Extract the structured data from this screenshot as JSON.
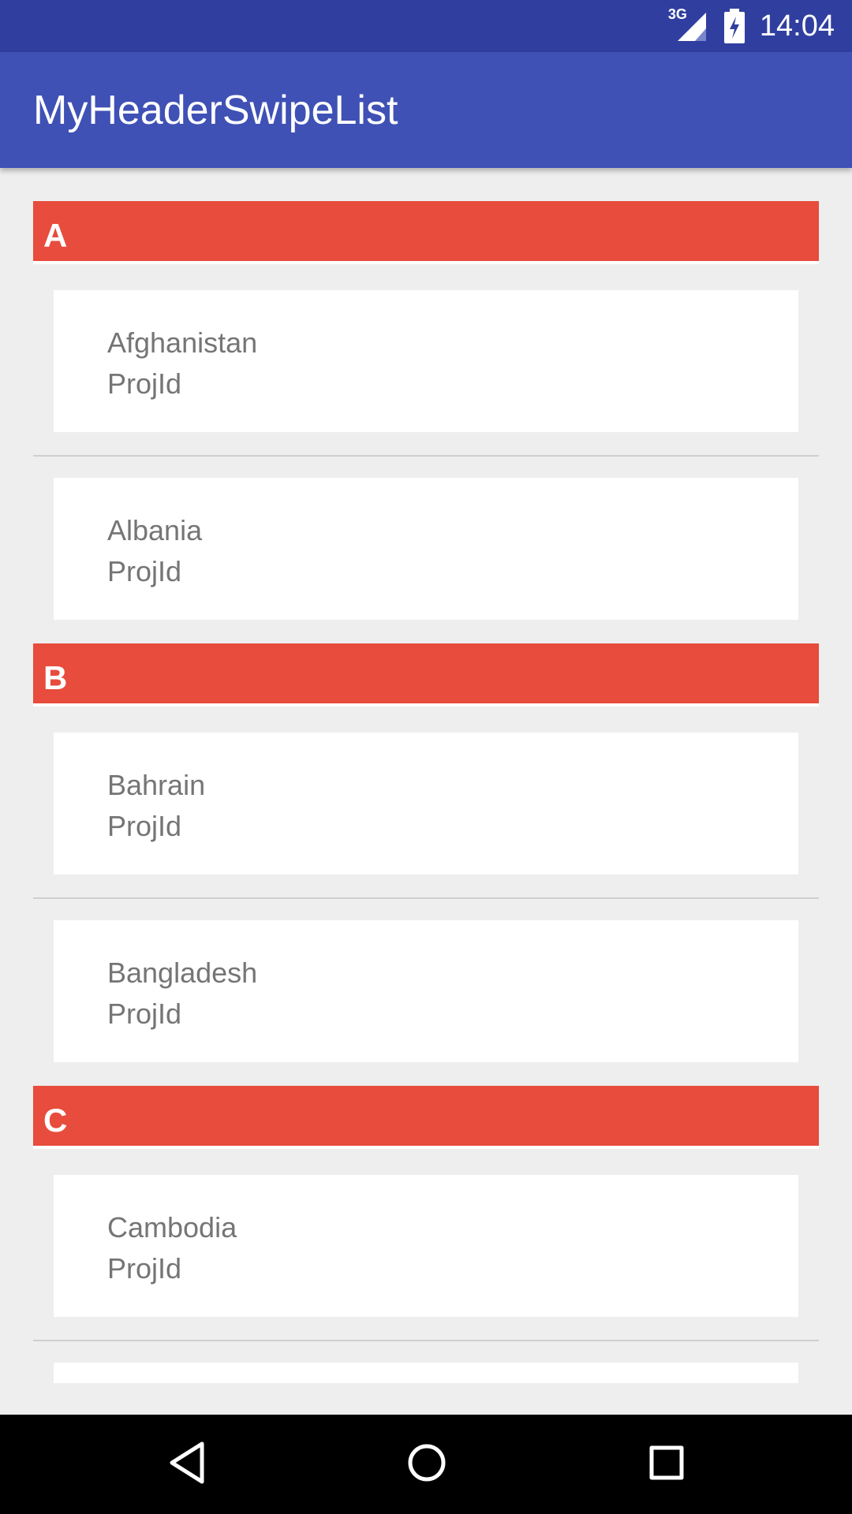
{
  "status_bar": {
    "network": "3G",
    "time": "14:04"
  },
  "app_bar": {
    "title": "MyHeaderSwipeList"
  },
  "sections": [
    {
      "letter": "A",
      "items": [
        {
          "name": "Afghanistan",
          "sub": "ProjId"
        },
        {
          "name": "Albania",
          "sub": "ProjId"
        }
      ]
    },
    {
      "letter": "B",
      "items": [
        {
          "name": "Bahrain",
          "sub": "ProjId"
        },
        {
          "name": "Bangladesh",
          "sub": "ProjId"
        }
      ]
    },
    {
      "letter": "C",
      "items": [
        {
          "name": "Cambodia",
          "sub": "ProjId"
        }
      ]
    }
  ],
  "nav_bar": {
    "back_icon": "back-triangle-icon",
    "home_icon": "home-circle-icon",
    "recents_icon": "recents-square-icon"
  },
  "colors": {
    "status_bar": "#303f9f",
    "app_bar": "#3f51b5",
    "section_header": "#e74c3c",
    "background": "#eeeeee"
  }
}
